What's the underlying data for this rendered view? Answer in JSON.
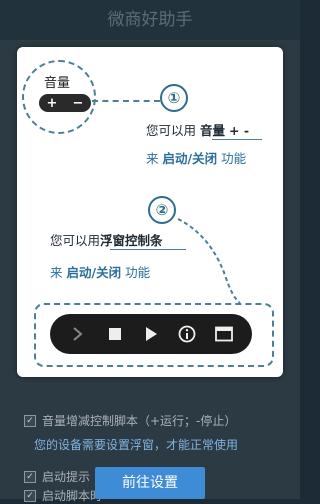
{
  "app": {
    "title": "微商好助手"
  },
  "background_settings": [
    {
      "label": "音量增减控制脚本（+运行；-停止）",
      "checked": true
    },
    {
      "label": "启动提示",
      "checked": true
    },
    {
      "label": "启动脚本时",
      "checked": true
    }
  ],
  "guide": {
    "volume_label": "音量",
    "step1": {
      "number": "①",
      "line1_prefix": "您可以用",
      "line1_strong": "音量",
      "line1_suffix": "+ -",
      "line2_prefix": "来",
      "line2_strong": "启动/关闭",
      "line2_suffix": "功能"
    },
    "step2": {
      "number": "②",
      "line1_prefix": "您可以用",
      "line1_strong": "浮窗控制条",
      "line2_prefix": "来",
      "line2_strong": "启动/关闭",
      "line2_suffix": "功能"
    }
  },
  "notice": "您的设备需要设置浮窗，才能正常使用",
  "go_button": "前往设置",
  "colors": {
    "accent": "#3e8bd6",
    "dash": "#4a7f97",
    "step_number": "#2e6e8b"
  }
}
